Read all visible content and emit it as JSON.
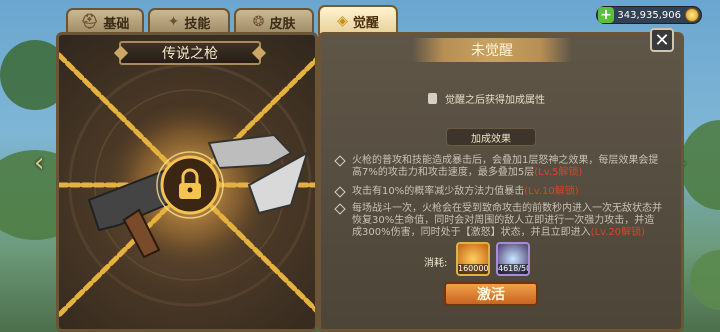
{
  "tabs": [
    {
      "label": "基础",
      "icon": "helmet-icon"
    },
    {
      "label": "技能",
      "icon": "skill-icon"
    },
    {
      "label": "皮肤",
      "icon": "skin-icon"
    },
    {
      "label": "觉醒",
      "icon": "awaken-icon",
      "active": true
    }
  ],
  "currency": {
    "value": "343,935,906",
    "plus": "+"
  },
  "weapon": {
    "name": "传说之枪"
  },
  "awakening": {
    "status": "未觉醒",
    "lock_hint": "觉醒之后获得加成属性",
    "section_title": "加成效果",
    "effects": [
      {
        "text": "火枪的普攻和技能造成暴击后，会叠加1层怒神之效果，每层效果会提高7%的攻击力和攻击速度，最多叠加5层",
        "highlight": "(Lv.5解锁)"
      },
      {
        "text": "攻击有10%的概率减少敌方法力值暴击",
        "highlight": "(Lv.10解锁)"
      },
      {
        "text": "每场战斗一次，火枪会在受到致命攻击的前数秒内进入一次无敌状态并恢复30%生命值，同时会对周围的敌人立即进行一次强力攻击，并造成300%伤害，同时处于【激怒】状态，并且立即进入",
        "highlight": "(Lv.20解锁)"
      }
    ],
    "cost_label": "消耗:",
    "costs": [
      {
        "name": "gold-item-icon",
        "count": "160000"
      },
      {
        "name": "awaken-stone-icon",
        "count": "4618/500"
      }
    ],
    "button": "激活"
  },
  "colors": {
    "accent": "#d8442b",
    "gold": "#e8b23a",
    "button": "#e08a3a"
  }
}
